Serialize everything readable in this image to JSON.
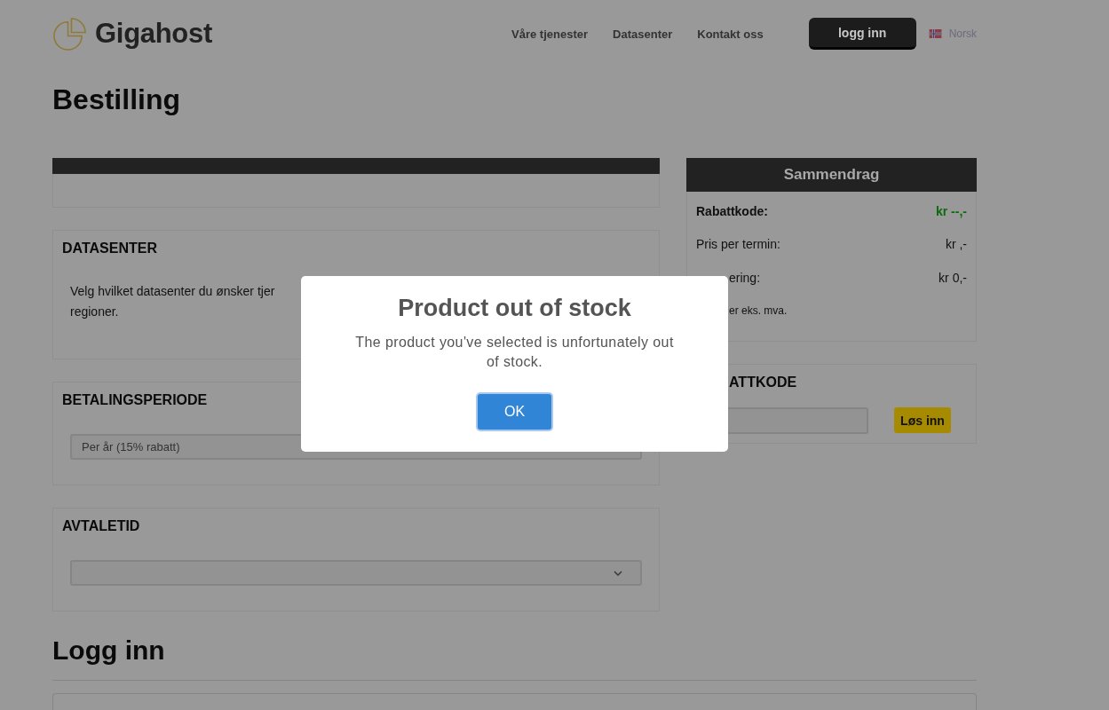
{
  "header": {
    "logo_text": "Gigahost",
    "nav": [
      {
        "label": "Våre tjenester"
      },
      {
        "label": "Datasenter"
      },
      {
        "label": "Kontakt oss"
      }
    ],
    "login_button": "logg inn",
    "language": "Norsk"
  },
  "page_title": "Bestilling",
  "sections": [
    {
      "kind": "empty"
    },
    {
      "kind": "text",
      "title": "DATASENTER",
      "lines": [
        "Velg hvilket datasenter du ønsker tjer",
        "regioner."
      ]
    },
    {
      "kind": "select",
      "title": "BETALINGSPERIODE",
      "value": "Per år (15% rabatt)",
      "chevron": false
    },
    {
      "kind": "select",
      "title": "AVTALETID",
      "chevron": true
    }
  ],
  "summary": {
    "title": "Sammendrag",
    "rows": [
      {
        "kind": "discount",
        "label": "Rabattkode:",
        "value": "kr --,-"
      },
      {
        "kind": "plain",
        "label": "Pris per termin:",
        "value": "kr ,-"
      },
      {
        "kind": "plain",
        "label": "ering:",
        "value": "kr 0,-",
        "partly_hidden": true
      }
    ],
    "note": {
      "text": "er eks. mva.",
      "partly_hidden": true
    }
  },
  "discount": {
    "title": "ATTKODE",
    "partly_hidden": true,
    "button": "Løs inn"
  },
  "login": {
    "title": "Logg inn"
  },
  "dialog": {
    "title": "Product out of stock",
    "message": "The product you've selected is unfortunately out of stock.",
    "button": "OK"
  }
}
